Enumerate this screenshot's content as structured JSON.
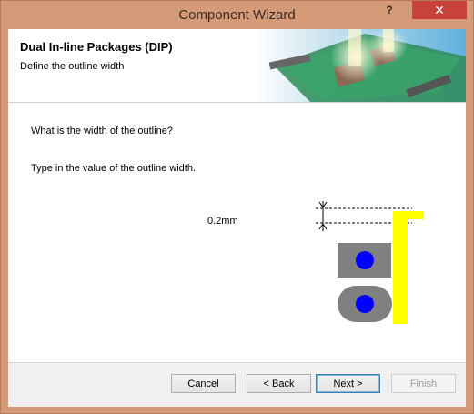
{
  "window": {
    "title": "Component Wizard",
    "help_glyph": "?",
    "close_glyph": "✕"
  },
  "header": {
    "title": "Dual In-line Packages (DIP)",
    "subtitle": "Define the outline width"
  },
  "body": {
    "question": "What is the width of the outline?",
    "instruction": "Type in the value of the outline width.",
    "outline_width_value": "0.2mm"
  },
  "diagram": {
    "outline_color": "#ffff00",
    "pad_color": "#808080",
    "hole_color": "#0000ff"
  },
  "footer": {
    "cancel_label": "Cancel",
    "back_label": "< Back",
    "next_label": "Next >",
    "finish_label": "Finish"
  }
}
